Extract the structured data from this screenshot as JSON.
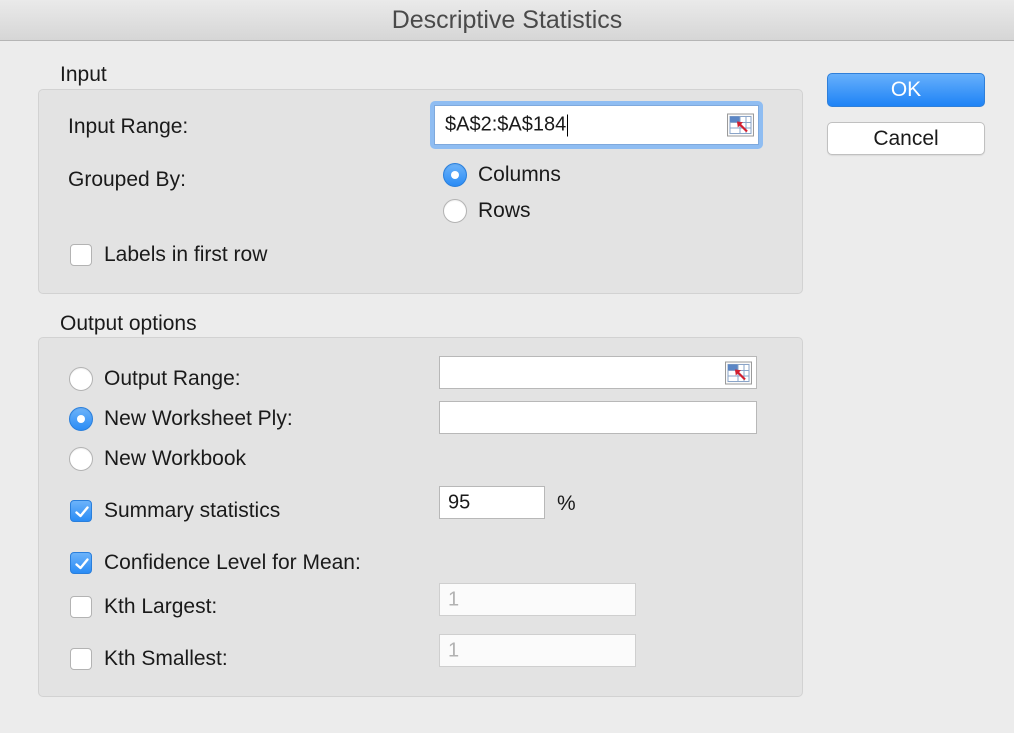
{
  "window": {
    "title": "Descriptive Statistics"
  },
  "input": {
    "section_label": "Input",
    "input_range_label": "Input Range:",
    "input_range_value": "$A$2:$A$184",
    "grouped_by_label": "Grouped By:",
    "grouped_by_options": [
      {
        "label": "Columns",
        "selected": true
      },
      {
        "label": "Rows",
        "selected": false
      }
    ],
    "labels_first_row": {
      "label": "Labels in first row",
      "checked": false
    }
  },
  "output": {
    "section_label": "Output options",
    "output_range": {
      "label": "Output Range:",
      "selected": false,
      "value": ""
    },
    "new_worksheet_ply": {
      "label": "New Worksheet Ply:",
      "selected": true,
      "value": ""
    },
    "new_workbook": {
      "label": "New Workbook",
      "selected": false
    },
    "summary_statistics": {
      "label": "Summary statistics",
      "checked": true
    },
    "confidence_value": "95",
    "confidence_unit": "%",
    "confidence_level": {
      "label": "Confidence Level for Mean:",
      "checked": true
    },
    "kth_largest": {
      "label": "Kth Largest:",
      "checked": false,
      "value": "1"
    },
    "kth_smallest": {
      "label": "Kth Smallest:",
      "checked": false,
      "value": "1"
    }
  },
  "buttons": {
    "ok": "OK",
    "cancel": "Cancel"
  },
  "icons": {
    "range_selector": "range-selector-icon",
    "checkmark": "checkmark-icon"
  },
  "colors": {
    "accent": "#2a8cf5",
    "panel": "#e3e3e3",
    "background": "#ececec"
  }
}
